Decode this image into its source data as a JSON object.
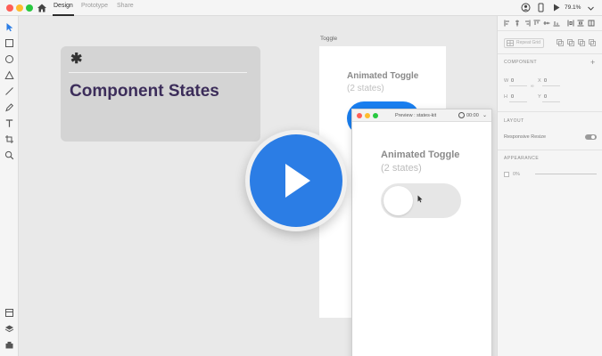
{
  "titlebar": {
    "tabs": [
      {
        "label": "Design",
        "active": true
      },
      {
        "label": "Prototype",
        "active": false
      },
      {
        "label": "Share",
        "active": false
      }
    ],
    "zoom": "79.1%",
    "icons": [
      "home-icon",
      "user-icon",
      "phone-icon",
      "play-icon",
      "chevron-down-icon"
    ]
  },
  "toolbar": {
    "tools": [
      "select-tool-icon",
      "rectangle-tool-icon",
      "ellipse-tool-icon",
      "triangle-tool-icon",
      "line-tool-icon",
      "pen-tool-icon",
      "text-tool-icon",
      "artboard-tool-icon",
      "zoom-tool-icon"
    ],
    "bottom": [
      "assets-icon",
      "layers-icon",
      "plugins-icon"
    ]
  },
  "canvas": {
    "card": {
      "star": "✱",
      "title": "Component States"
    },
    "artboard": {
      "label": "Toggle",
      "title": "Animated Toggle",
      "subtitle": "(2 states)",
      "toggle_on": true
    },
    "preview": {
      "name": "Preview : states-kit",
      "time": "00:00",
      "title": "Animated Toggle",
      "subtitle": "(2 states)",
      "toggle_on": false
    },
    "play_button": "play-icon"
  },
  "panel": {
    "repeat_grid": "Repeat Grid",
    "component_heading": "COMPONENT",
    "w_label": "W",
    "w_value": "0",
    "h_label": "H",
    "h_value": "0",
    "x_label": "X",
    "x_value": "0",
    "y_label": "Y",
    "y_value": "0",
    "layout_heading": "LAYOUT",
    "responsive_resize": "Responsive Resize",
    "responsive_resize_on": true,
    "appearance_heading": "APPEARANCE",
    "opacity": "0%"
  },
  "colors": {
    "accent": "#2b7de5",
    "toggle_on": "#1a7ff0",
    "card_title": "#3c2d5a",
    "traffic_red": "#fe5f57",
    "traffic_yellow": "#febc2e",
    "traffic_green": "#28c840"
  }
}
